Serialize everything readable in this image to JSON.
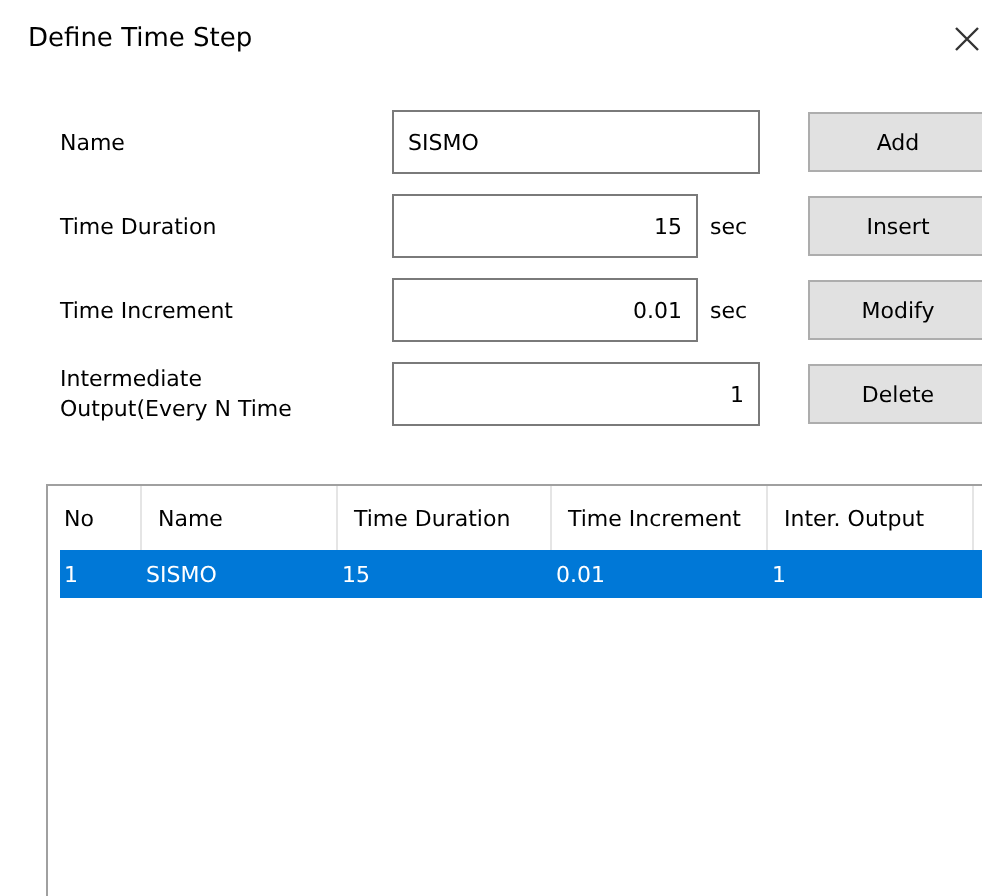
{
  "window": {
    "title": "Define Time Step"
  },
  "fields": [
    {
      "label": "Name",
      "value": "SISMO",
      "kind": "text"
    },
    {
      "label": "Time Duration",
      "value": "15",
      "unit": "sec",
      "kind": "number"
    },
    {
      "label": "Time Increment",
      "value": "0.01",
      "unit": "sec",
      "kind": "number"
    },
    {
      "label": "Intermediate\nOutput(Every N Time",
      "value": "1",
      "kind": "number"
    }
  ],
  "buttons": [
    "Add",
    "Insert",
    "Modify",
    "Delete"
  ],
  "table": {
    "columns": [
      "No",
      "Name",
      "Time Duration",
      "Time Increment",
      "Inter. Output"
    ],
    "rows": [
      {
        "cells": [
          "1",
          "SISMO",
          "15",
          "0.01",
          "1"
        ],
        "selected": true
      }
    ]
  }
}
